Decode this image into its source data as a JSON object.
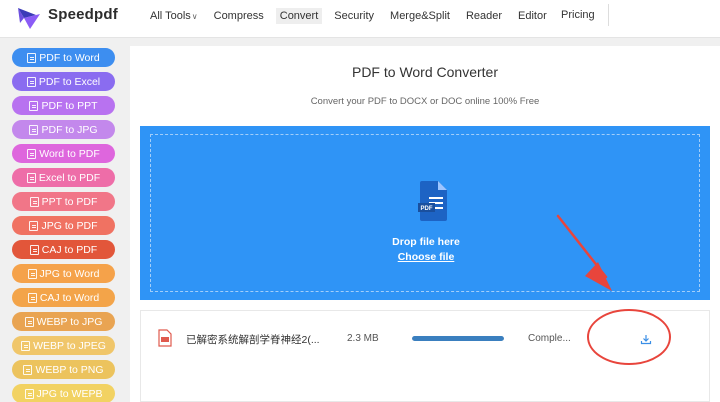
{
  "header": {
    "brand": "Speedpdf",
    "nav": [
      {
        "label": "All Tools",
        "dropdown": true,
        "active": false
      },
      {
        "label": "Compress",
        "dropdown": false,
        "active": false
      },
      {
        "label": "Convert",
        "dropdown": false,
        "active": true
      },
      {
        "label": "Security",
        "dropdown": false,
        "active": false
      },
      {
        "label": "Merge&Split",
        "dropdown": false,
        "active": false
      },
      {
        "label": "Reader",
        "dropdown": false,
        "active": false
      },
      {
        "label": "Editor",
        "dropdown": false,
        "active": false
      }
    ],
    "pricing": "Pricing",
    "chevron": "∨"
  },
  "sidebar": {
    "items": [
      {
        "label": "PDF to Word",
        "color": "#3d8ef0"
      },
      {
        "label": "PDF to Excel",
        "color": "#8a6cf0"
      },
      {
        "label": "PDF to PPT",
        "color": "#b872f0"
      },
      {
        "label": "PDF to JPG",
        "color": "#c388ec"
      },
      {
        "label": "Word to PDF",
        "color": "#de66dd"
      },
      {
        "label": "Excel to PDF",
        "color": "#ee6da8"
      },
      {
        "label": "PPT to PDF",
        "color": "#f17688"
      },
      {
        "label": "JPG to PDF",
        "color": "#f07262"
      },
      {
        "label": "CAJ to PDF",
        "color": "#e2563a"
      },
      {
        "label": "JPG to Word",
        "color": "#f5a24a"
      },
      {
        "label": "CAJ to Word",
        "color": "#f3a449"
      },
      {
        "label": "WEBP to JPG",
        "color": "#e9a452"
      },
      {
        "label": "WEBP to JPEG",
        "color": "#f0c66a"
      },
      {
        "label": "WEBP to PNG",
        "color": "#ecc35d"
      },
      {
        "label": "JPG to WEPB",
        "color": "#f2d262"
      }
    ]
  },
  "main": {
    "title": "PDF to Word Converter",
    "subtitle": "Convert your PDF to DOCX or DOC online 100% Free",
    "dropzone": {
      "icon_label": "PDF",
      "text": "Drop file here",
      "link": "Choose file",
      "color": "#2f94f6"
    },
    "file": {
      "name": "已解密系统解剖学脊神经2(...",
      "size": "2.3 MB",
      "progress": 1.0,
      "status": "Comple...",
      "icon": "pdf-file-icon",
      "action_icon": "download-icon"
    }
  },
  "annotation": {
    "color": "#e8453c",
    "shapes": [
      "arrow-icon",
      "circle-highlight"
    ]
  }
}
